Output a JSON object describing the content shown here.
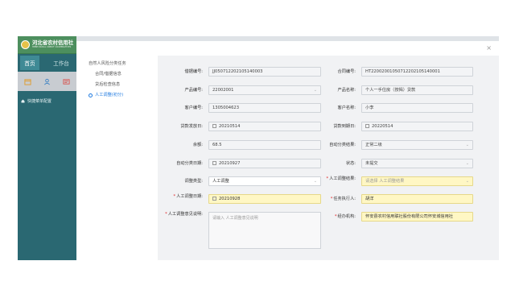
{
  "app": {
    "logo_title": "河北省农村信用社",
    "logo_subtitle": "HEBEI RURAL CREDIT COOPERATIVES",
    "top_tabs": [
      "首页",
      "工作台"
    ],
    "quick_nav": "快捷菜单配置",
    "colors": {
      "sidebar": "#2a6872",
      "accent": "#1f7ae0",
      "required_field": "#fff7c4"
    }
  },
  "dialog": {
    "close": "×",
    "steps": [
      {
        "label": "自然人风险分类任务"
      },
      {
        "label": "合同/借据信息"
      },
      {
        "label": "贷后检查信息"
      },
      {
        "label": "人工调整(初分)"
      }
    ],
    "form": {
      "loan_no": {
        "label": "借据编号:",
        "value": "JJ050712202105140003"
      },
      "contract_no": {
        "label": "合同编号:",
        "value": "HT22002001050712202105140001"
      },
      "product_no": {
        "label": "产品编号:",
        "value": "22002001"
      },
      "product_name": {
        "label": "产品名称:",
        "value": "个人一手住房（按揭）贷款"
      },
      "customer_no": {
        "label": "客户编号:",
        "value": "1305004623"
      },
      "customer_name": {
        "label": "客户名称:",
        "value": "小李"
      },
      "issue_date": {
        "label": "贷款发放日:",
        "value": "20210514"
      },
      "due_date": {
        "label": "贷款到期日:",
        "value": "20220514"
      },
      "balance": {
        "label": "余额:",
        "value": "68.5"
      },
      "auto_result": {
        "label": "自动分类结果:",
        "value": "正常二级"
      },
      "auto_date": {
        "label": "自动分类日期:",
        "value": "20210927"
      },
      "status": {
        "label": "状态:",
        "value": "未提交"
      },
      "adjust_type": {
        "label": "调整类型:",
        "value": "人工调整"
      },
      "manual_result": {
        "label": "人工调整结果:",
        "placeholder": "请选择 人工调整结果"
      },
      "manual_date": {
        "label": "人工调整日期:",
        "value": "20210928"
      },
      "executor": {
        "label": "任务执行人:",
        "value": "胡洋"
      },
      "opinion": {
        "label": "人工调整意见说明:",
        "placeholder": "请输入 人工调整意见说明"
      },
      "institution": {
        "label": "经办机构:",
        "value": "怀安县农村信用联社股份有限公司怀安城信用社"
      }
    }
  }
}
